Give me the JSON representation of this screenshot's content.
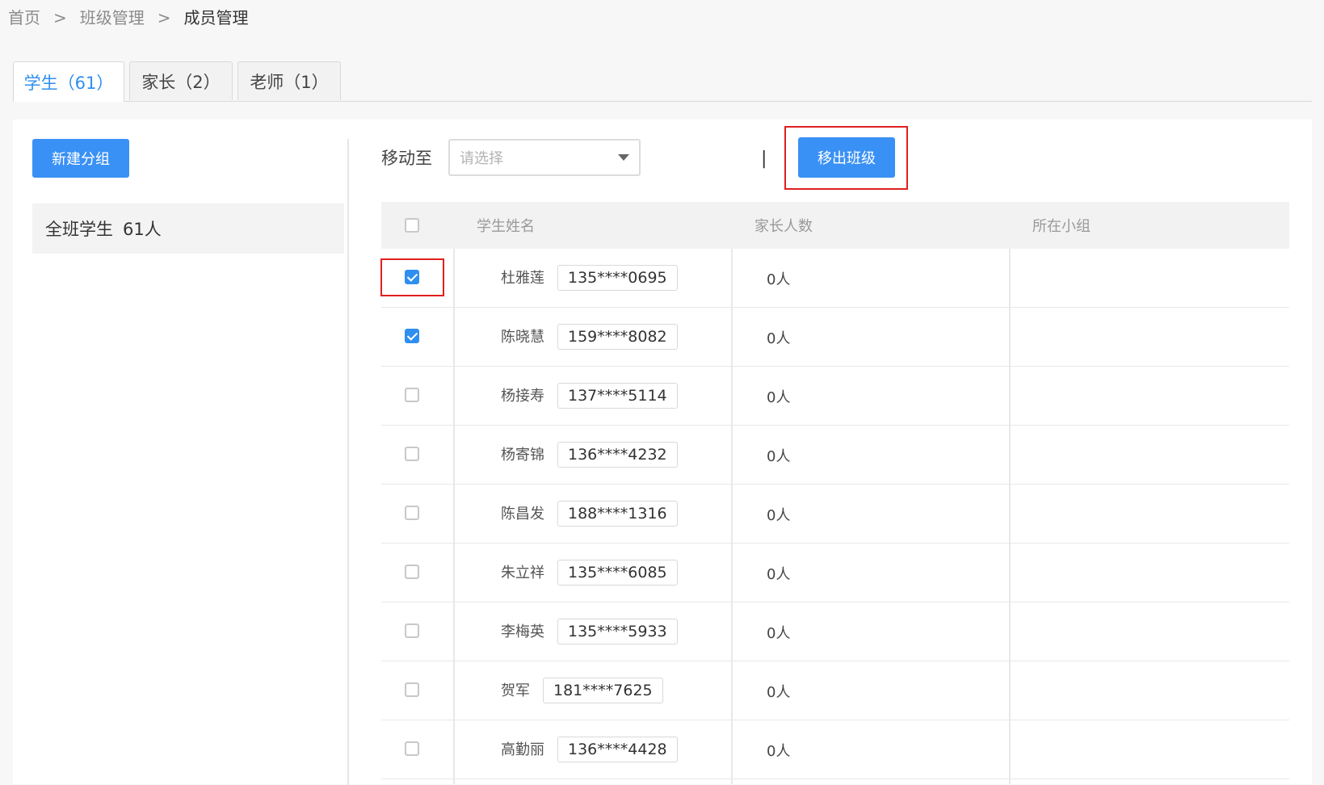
{
  "breadcrumb": {
    "home": "首页",
    "class_mgmt": "班级管理",
    "current": "成员管理",
    "separator": ">"
  },
  "tabs": [
    {
      "label": "学生（61）",
      "active": true
    },
    {
      "label": "家长（2）",
      "active": false
    },
    {
      "label": "老师（1）",
      "active": false
    }
  ],
  "sidebar": {
    "new_group_label": "新建分组",
    "group_name": "全班学生",
    "group_count": "61人"
  },
  "toolbar": {
    "move_to_label": "移动至",
    "select_placeholder": "请选择",
    "divider": "|",
    "remove_label": "移出班级"
  },
  "table": {
    "headers": {
      "name": "学生姓名",
      "parents": "家长人数",
      "group": "所在小组"
    },
    "rows": [
      {
        "name": "杜雅莲",
        "phone": "135****0695",
        "parents": "0人",
        "group": "",
        "checked": true
      },
      {
        "name": "陈晓慧",
        "phone": "159****8082",
        "parents": "0人",
        "group": "",
        "checked": true
      },
      {
        "name": "杨接寿",
        "phone": "137****5114",
        "parents": "0人",
        "group": "",
        "checked": false
      },
      {
        "name": "杨寄锦",
        "phone": "136****4232",
        "parents": "0人",
        "group": "",
        "checked": false
      },
      {
        "name": "陈昌发",
        "phone": "188****1316",
        "parents": "0人",
        "group": "",
        "checked": false
      },
      {
        "name": "朱立祥",
        "phone": "135****6085",
        "parents": "0人",
        "group": "",
        "checked": false
      },
      {
        "name": "李梅英",
        "phone": "135****5933",
        "parents": "0人",
        "group": "",
        "checked": false
      },
      {
        "name": "贺军",
        "phone": "181****7625",
        "parents": "0人",
        "group": "",
        "checked": false
      },
      {
        "name": "高勤丽",
        "phone": "136****4428",
        "parents": "0人",
        "group": "",
        "checked": false
      }
    ]
  },
  "colors": {
    "primary": "#3a91f5",
    "highlight": "#e02020"
  }
}
